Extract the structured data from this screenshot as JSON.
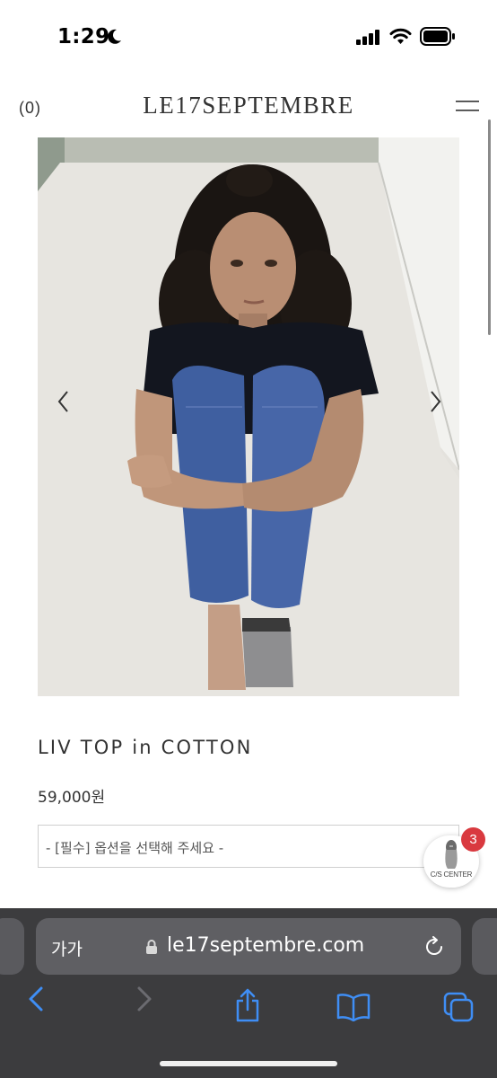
{
  "status_bar": {
    "time": "1:29"
  },
  "header": {
    "cart_count": "(0)",
    "logo": "LE17SEPTEMBRE"
  },
  "product": {
    "name": "LIV TOP in COTTON",
    "price": "59,000원",
    "option_placeholder": "- [필수] 옵션을 선택해 주세요 -"
  },
  "cs_widget": {
    "label": "C/S CENTER",
    "badge": "3"
  },
  "browser": {
    "text_size_label": "가가",
    "url": "le17septembre.com"
  },
  "colors": {
    "toolbar_bg": "#3c3c3e",
    "url_bar_bg": "#5f5f63",
    "accent_blue": "#3f8ef5",
    "badge_red": "#d9393f"
  }
}
